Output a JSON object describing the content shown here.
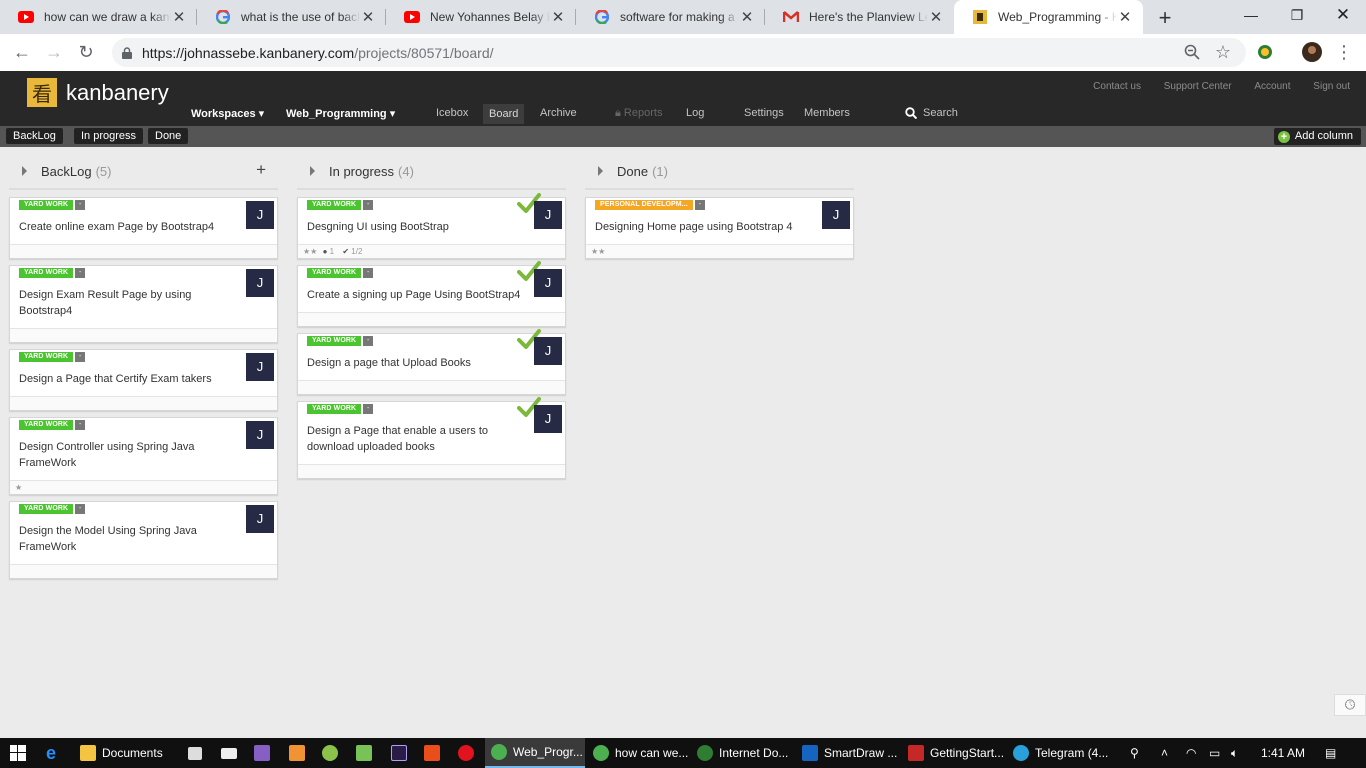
{
  "browser": {
    "tabs": [
      {
        "title": "how can we draw a kanban",
        "favicon": "youtube-icon",
        "color": "#ff0000"
      },
      {
        "title": "what is the use of backlog",
        "favicon": "google-icon",
        "color": "#4285f4"
      },
      {
        "title": "New Yohannes Belay Ethiopian",
        "favicon": "youtube-icon",
        "color": "#ff0000"
      },
      {
        "title": "software for making a kanban",
        "favicon": "google-icon",
        "color": "#4285f4"
      },
      {
        "title": "Here's the Planview LeanKit",
        "favicon": "gmail-icon",
        "color": "#d93025"
      },
      {
        "title": "Web_Programming - Kanbanery",
        "favicon": "kanbanery-icon",
        "color": "#e9b83b",
        "active": true
      }
    ],
    "new_tab": "+",
    "url_host": "https://johnassebe.kanbanery.com",
    "url_path": "/projects/80571/board/"
  },
  "app": {
    "logo_char": "看",
    "logo_text": "kanbanery",
    "top_links": [
      "Contact us",
      "Support Center",
      "Account",
      "Sign out"
    ],
    "nav": {
      "workspaces": "Workspaces ▾",
      "project": "Web_Programming ▾",
      "icebox": "Icebox",
      "board": "Board",
      "archive": "Archive",
      "reports": "Reports",
      "log": "Log",
      "settings": "Settings",
      "members": "Members",
      "search": "Search"
    },
    "column_buttons": [
      "BackLog",
      "In progress",
      "Done"
    ],
    "add_column": "Add column"
  },
  "board": {
    "columns": [
      {
        "name": "BackLog",
        "count": "(5)",
        "add": "+",
        "cards": [
          {
            "tag": "YARD WORK",
            "title": "Create online exam Page by Bootstrap4",
            "avatar": "J",
            "foot": ""
          },
          {
            "tag": "YARD WORK",
            "title": "Design Exam Result Page by using Bootstrap4",
            "avatar": "J",
            "foot": ""
          },
          {
            "tag": "YARD WORK",
            "title": "Design a Page that Certify Exam takers",
            "avatar": "J",
            "foot": ""
          },
          {
            "tag": "YARD WORK",
            "title": "Design Controller using Spring Java FrameWork",
            "avatar": "J",
            "foot": "★"
          },
          {
            "tag": "YARD WORK",
            "title": "Design the Model Using Spring Java FrameWork",
            "avatar": "J",
            "foot": ""
          }
        ]
      },
      {
        "name": "In progress",
        "count": "(4)",
        "cards": [
          {
            "tag": "YARD WORK",
            "title": "Desgning UI using BootStrap",
            "avatar": "J",
            "foot_stars": "★★",
            "foot_comments": "1",
            "foot_tasks": "1/2"
          },
          {
            "tag": "YARD WORK",
            "title": "Create a signing up Page Using BootStrap4",
            "avatar": "J",
            "foot": ""
          },
          {
            "tag": "YARD WORK",
            "title": "Design a page that Upload Books",
            "avatar": "J",
            "foot": ""
          },
          {
            "tag": "YARD WORK",
            "title": "Design a Page that enable a users to download uploaded books",
            "avatar": "J",
            "foot": ""
          }
        ]
      },
      {
        "name": "Done",
        "count": "(1)",
        "cards": [
          {
            "tag": "PERSONAL DEVELOPM...",
            "title": "Designing Home page using Bootstrap 4",
            "avatar": "J",
            "foot": "★★"
          }
        ]
      }
    ],
    "tag_dash": "-",
    "colors": {
      "green_tag": "#4bc52f",
      "orange_tag": "#f5a623",
      "avatar": "#262a44",
      "check": "#7cb83a"
    }
  },
  "taskbar": {
    "items": [
      "Documents",
      "Web_Progr...",
      "how can we...",
      "Internet Do...",
      "SmartDraw ...",
      "GettingStart...",
      "Telegram (4..."
    ],
    "time": "1:41 AM"
  }
}
